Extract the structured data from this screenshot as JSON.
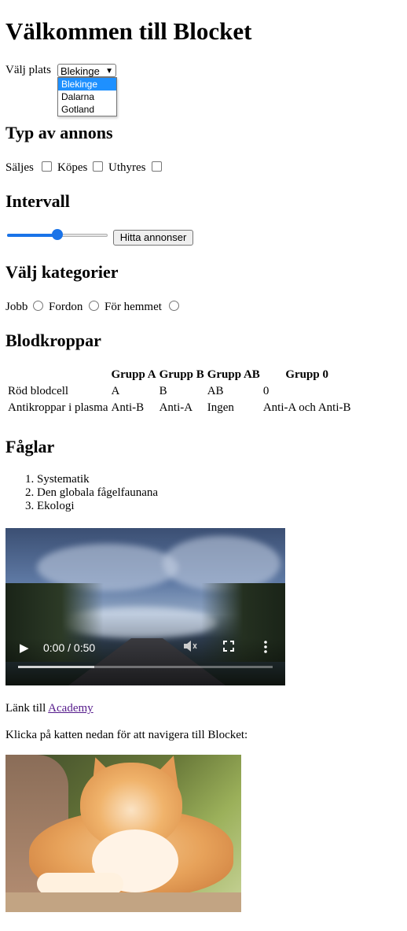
{
  "title": "Välkommen till Blocket",
  "location": {
    "label": "Välj plats",
    "selected": "Blekinge",
    "options": [
      "Blekinge",
      "Dalarna",
      "Gotland"
    ]
  },
  "ad_type": {
    "heading": "Typ av annons",
    "options": [
      "Säljes",
      "Köpes",
      "Uthyres"
    ]
  },
  "interval": {
    "heading": "Intervall",
    "slider_value_fraction": 0.5,
    "button_label": "Hitta annonser"
  },
  "categories": {
    "heading": "Välj kategorier",
    "options": [
      "Jobb",
      "Fordon",
      "För hemmet"
    ]
  },
  "blood": {
    "heading": "Blodkroppar",
    "headers": [
      "",
      "Grupp A",
      "Grupp B",
      "Grupp AB",
      "Grupp 0"
    ],
    "rows": [
      [
        "Röd blodcell",
        "A",
        "B",
        "AB",
        "0"
      ],
      [
        "Antikroppar i plasma",
        "Anti-B",
        "Anti-A",
        "Ingen",
        "Anti-A och Anti-B"
      ]
    ]
  },
  "birds": {
    "heading": "Fåglar",
    "items": [
      "Systematik",
      "Den globala fågelfaunana",
      "Ekologi"
    ]
  },
  "video": {
    "time": "0:00 / 0:50",
    "buffered_fraction": 0.3,
    "icons": [
      "play-icon",
      "mute-icon",
      "fullscreen-icon",
      "more-options-icon"
    ]
  },
  "link_line": {
    "prefix": "Länk till ",
    "link_text": "Academy"
  },
  "cat_caption": "Klicka på katten nedan för att navigera till Blocket:",
  "colors": {
    "link_visited": "#551a8b",
    "accent": "#1a73e8",
    "option_highlight": "#1e90ff"
  }
}
